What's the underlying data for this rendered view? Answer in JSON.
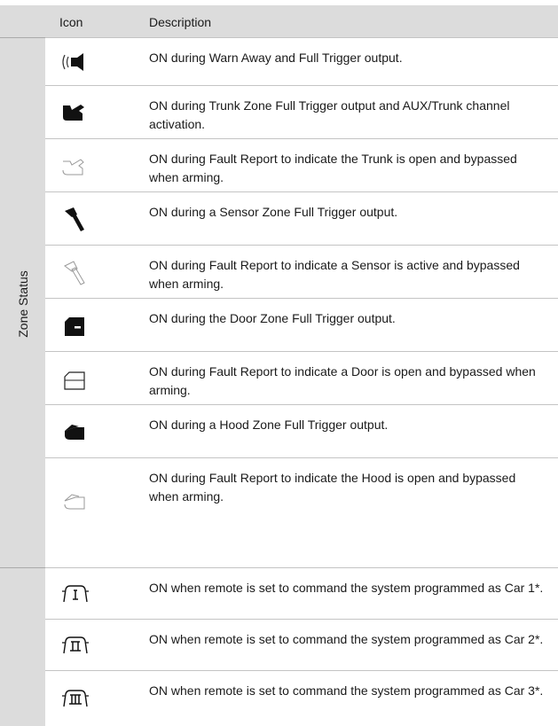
{
  "header": {
    "icon_col": "Icon",
    "description_col": "Description"
  },
  "side_label": "Zone Status",
  "rows": [
    {
      "icon": "siren-icon",
      "description": "ON during Warn Away and Full Trigger output."
    },
    {
      "icon": "trunk-open-icon",
      "description": "ON during Trunk Zone Full Trigger output and AUX/Trunk channel activation."
    },
    {
      "icon": "trunk-bypass-icon",
      "description": "ON during Fault Report to indicate the Trunk is open and bypassed when arming."
    },
    {
      "icon": "sensor-hammer-icon",
      "description": "ON during a Sensor Zone Full Trigger output."
    },
    {
      "icon": "sensor-bypass-icon",
      "description": "ON during Fault Report to indicate a Sensor is active and  bypassed when arming."
    },
    {
      "icon": "door-open-icon",
      "description": "ON during the Door Zone Full Trigger output."
    },
    {
      "icon": "door-bypass-icon",
      "description": "ON during Fault Report to indicate a Door is open and bypassed when arming."
    },
    {
      "icon": "hood-open-icon",
      "description": "ON during a Hood Zone Full Trigger output."
    },
    {
      "icon": "hood-bypass-icon",
      "description": "ON during Fault Report to indicate the Hood is open and bypassed when arming."
    },
    {
      "icon": "car-1-icon",
      "description": "ON when remote is set to command the system programmed  as Car 1*."
    },
    {
      "icon": "car-2-icon",
      "description": "ON when remote is set to command the system programmed  as Car 2*."
    },
    {
      "icon": "car-3-icon",
      "description": "ON when remote is set to command the system programmed  as Car 3*."
    }
  ]
}
